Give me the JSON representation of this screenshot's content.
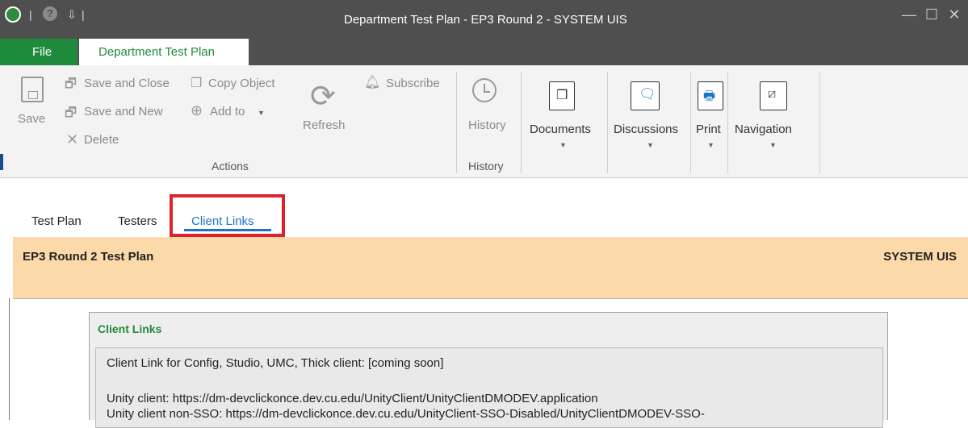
{
  "window": {
    "title": "Department Test Plan - EP3 Round 2 - SYSTEM UIS",
    "minimize": "—",
    "maximize": "☐",
    "close": "✕",
    "qa_help": "?",
    "qa_sep1": "|",
    "qa_sep2": "|",
    "qa_more": "⇩"
  },
  "ribbon_tabs": {
    "file": "File",
    "active": "Department Test Plan"
  },
  "ribbon": {
    "save": "Save",
    "save_and_close": "Save and Close",
    "save_and_new": "Save and New",
    "delete": "Delete",
    "copy_object": "Copy Object",
    "add_to": "Add to",
    "subscribe": "Subscribe",
    "refresh": "Refresh",
    "history_button": "History",
    "documents": "Documents",
    "discussions": "Discussions",
    "print": "Print",
    "navigation": "Navigation",
    "group_actions": "Actions",
    "group_history": "History"
  },
  "tabs": {
    "test_plan": "Test Plan",
    "testers": "Testers",
    "client_links": "Client Links"
  },
  "banner": {
    "title": "EP3 Round 2 Test Plan",
    "system": "SYSTEM UIS"
  },
  "panel": {
    "title": "Client Links",
    "line1": "Client Link for Config, Studio, UMC, Thick client: [coming soon]",
    "line2": "Unity client: https://dm-devclickonce.dev.cu.edu/UnityClient/UnityClientDMODEV.application",
    "line3": "Unity client non-SSO: https://dm-devclickonce.dev.cu.edu/UnityClient-SSO-Disabled/UnityClientDMODEV-SSO-"
  }
}
